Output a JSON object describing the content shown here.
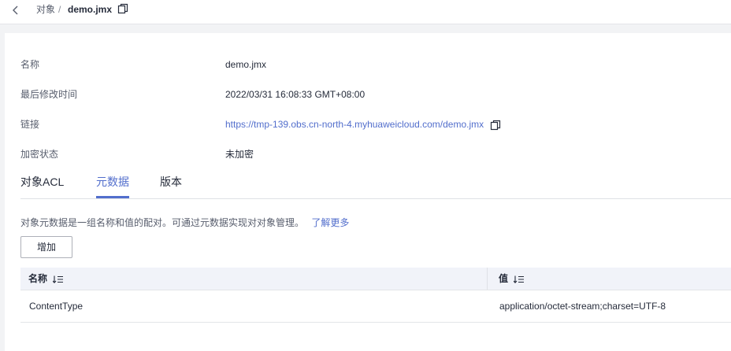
{
  "breadcrumb": {
    "parent": "对象",
    "separator": "/",
    "current": "demo.jmx"
  },
  "properties": [
    {
      "label": "名称",
      "value": "demo.jmx"
    },
    {
      "label": "最后修改时间",
      "value": "2022/03/31 16:08:33 GMT+08:00"
    },
    {
      "label": "链接",
      "value": "https://tmp-139.obs.cn-north-4.myhuaweicloud.com/demo.jmx"
    },
    {
      "label": "加密状态",
      "value": "未加密"
    }
  ],
  "tabs": [
    {
      "label": "对象ACL",
      "active": false
    },
    {
      "label": "元数据",
      "active": true
    },
    {
      "label": "版本",
      "active": false
    }
  ],
  "metadata": {
    "description": "对象元数据是一组名称和值的配对。可通过元数据实现对对象管理。",
    "learn_more": "了解更多",
    "add_button": "增加",
    "columns": [
      "名称",
      "值"
    ],
    "rows": [
      {
        "name": "ContentType",
        "value": "application/octet-stream;charset=UTF-8"
      }
    ]
  },
  "colors": {
    "accent": "#526ecc",
    "text": "#252b3a",
    "muted": "#575d6c",
    "header_bg": "#f1f3f9"
  },
  "icons": {
    "back": "chevron-left-icon",
    "copy": "copy-icon",
    "sort": "sort-icon"
  }
}
